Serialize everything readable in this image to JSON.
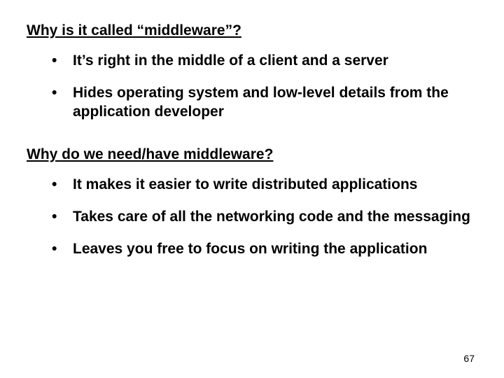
{
  "section1": {
    "heading": "Why is it called “middleware”?",
    "bullets": [
      "It’s right in the middle of a client and a server",
      "Hides operating system and low-level details from the application developer"
    ]
  },
  "section2": {
    "heading": "Why do we need/have middleware?",
    "bullets": [
      "It makes it easier to write distributed applications",
      "Takes care of all the networking code and the messaging",
      "Leaves you free to focus on writing the application"
    ]
  },
  "page_number": "67"
}
